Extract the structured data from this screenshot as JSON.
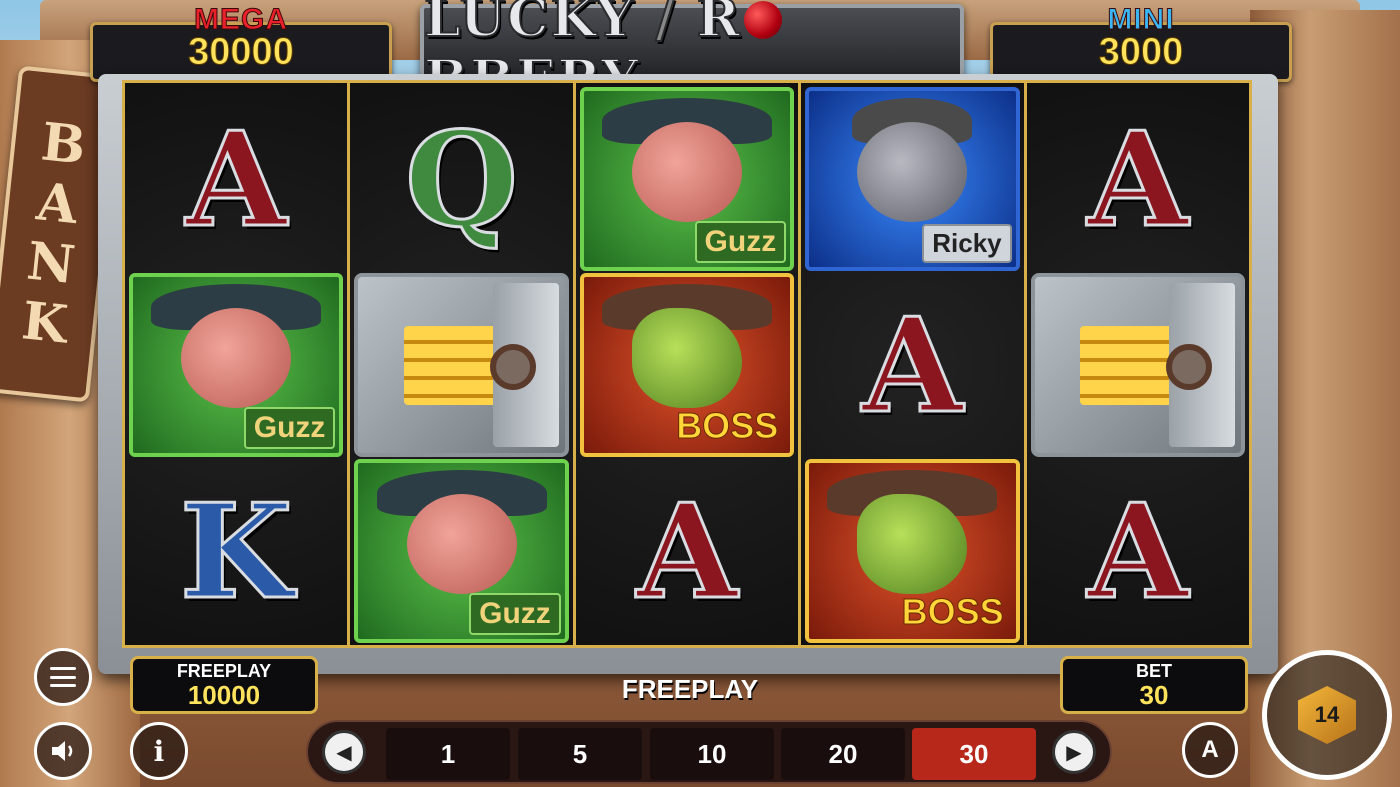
{
  "game": {
    "logo": {
      "left": "LUCKY",
      "right_a": "R",
      "right_b": "BBERY"
    },
    "jackpots": {
      "mega": {
        "label": "MEGA",
        "value": "30000",
        "color": "#e8202a"
      },
      "mini": {
        "label": "MINI",
        "value": "3000",
        "color": "#3bb6f5"
      }
    },
    "bank_sign": [
      "B",
      "A",
      "N",
      "K"
    ]
  },
  "reels": [
    {
      "symbols": [
        "A",
        "pig-guzz",
        "K"
      ]
    },
    {
      "symbols": [
        "Q",
        "vault",
        "pig-guzz"
      ]
    },
    {
      "symbols": [
        "pig-guzz",
        "croc-boss",
        "A"
      ]
    },
    {
      "symbols": [
        "rat-ricky",
        "A",
        "croc-boss"
      ]
    },
    {
      "symbols": [
        "A",
        "vault",
        "A"
      ]
    }
  ],
  "character_tags": {
    "pig": "Guzz",
    "croc": "BOSS",
    "rat": "Ricky"
  },
  "footer": {
    "freeplay": {
      "label": "FREEPLAY",
      "value": "10000"
    },
    "mode_label": "FREEPLAY",
    "bet": {
      "label": "BET",
      "value": "30"
    },
    "bet_options": [
      "1",
      "5",
      "10",
      "20",
      "30"
    ],
    "selected_bet": "30",
    "auto_label": "A",
    "spin_badge": "14"
  },
  "icons": {
    "menu": "hamburger-menu-icon",
    "sound": "speaker-icon",
    "info": "info-icon",
    "prev": "chevron-left-icon",
    "next": "chevron-right-icon",
    "auto": "autoplay-icon",
    "spin": "spin-icon"
  }
}
